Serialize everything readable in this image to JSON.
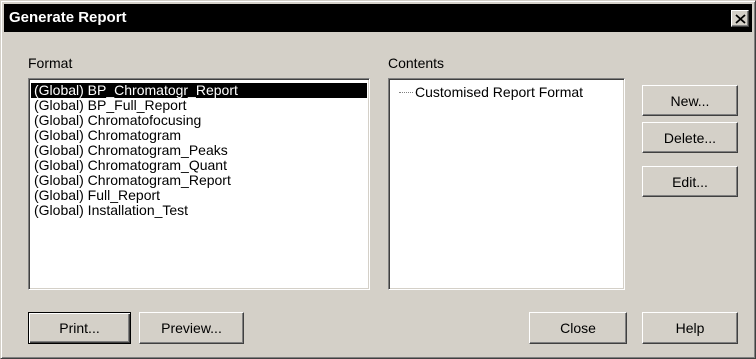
{
  "dialog": {
    "title": "Generate Report",
    "close_icon": "close-icon"
  },
  "format": {
    "label": "Format",
    "items": [
      "(Global) BP_Chromatogr_Report",
      "(Global) BP_Full_Report",
      "(Global) Chromatofocusing",
      "(Global) Chromatogram",
      "(Global) Chromatogram_Peaks",
      "(Global) Chromatogram_Quant",
      "(Global) Chromatogram_Report",
      "(Global) Full_Report",
      "(Global) Installation_Test"
    ],
    "selected": "(Global) BP_Chromatogr_Report"
  },
  "contents": {
    "label": "Contents",
    "items": [
      "Customised Report Format"
    ]
  },
  "buttons": {
    "new": "New...",
    "delete": "Delete...",
    "edit": "Edit...",
    "print": "Print...",
    "preview": "Preview...",
    "close": "Close",
    "help": "Help"
  },
  "colors": {
    "face": "#d4d0c8",
    "title_bg": "#000000",
    "title_fg": "#ffffff",
    "selection_bg": "#000000",
    "selection_fg": "#ffffff"
  }
}
